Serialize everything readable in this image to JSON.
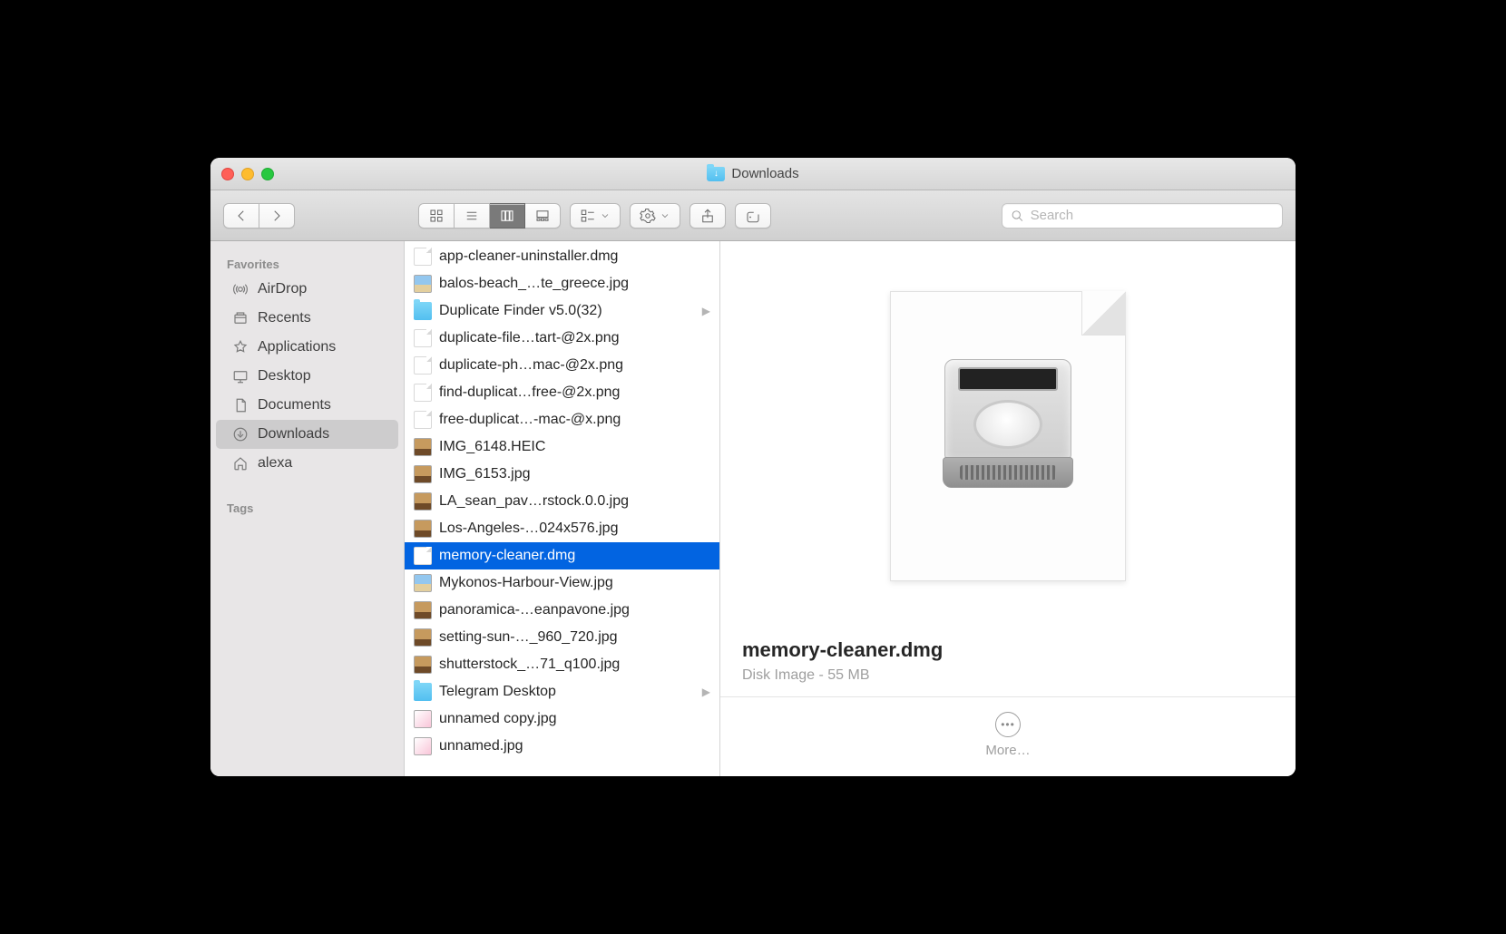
{
  "window": {
    "title": "Downloads"
  },
  "toolbar": {
    "search_placeholder": "Search"
  },
  "sidebar": {
    "favorites_heading": "Favorites",
    "tags_heading": "Tags",
    "items": [
      {
        "label": "AirDrop",
        "icon": "airdrop"
      },
      {
        "label": "Recents",
        "icon": "recents"
      },
      {
        "label": "Applications",
        "icon": "apps"
      },
      {
        "label": "Desktop",
        "icon": "desktop"
      },
      {
        "label": "Documents",
        "icon": "documents"
      },
      {
        "label": "Downloads",
        "icon": "downloads",
        "active": true
      },
      {
        "label": "alexa",
        "icon": "home"
      }
    ]
  },
  "files": [
    {
      "name": "app-cleaner-uninstaller.dmg",
      "kind": "doc"
    },
    {
      "name": "balos-beach_…te_greece.jpg",
      "kind": "img_sky"
    },
    {
      "name": "Duplicate Finder v5.0(32)",
      "kind": "folder",
      "arrow": true
    },
    {
      "name": "duplicate-file…tart-@2x.png",
      "kind": "doc"
    },
    {
      "name": "duplicate-ph…mac-@2x.png",
      "kind": "doc"
    },
    {
      "name": "find-duplicat…free-@2x.png",
      "kind": "doc"
    },
    {
      "name": "free-duplicat…-mac-@x.png",
      "kind": "doc"
    },
    {
      "name": "IMG_6148.HEIC",
      "kind": "img"
    },
    {
      "name": "IMG_6153.jpg",
      "kind": "img"
    },
    {
      "name": "LA_sean_pav…rstock.0.0.jpg",
      "kind": "img"
    },
    {
      "name": "Los-Angeles-…024x576.jpg",
      "kind": "img"
    },
    {
      "name": "memory-cleaner.dmg",
      "kind": "doc",
      "selected": true
    },
    {
      "name": "Mykonos-Harbour-View.jpg",
      "kind": "img_sky"
    },
    {
      "name": "panoramica-…eanpavone.jpg",
      "kind": "img"
    },
    {
      "name": "setting-sun-…_960_720.jpg",
      "kind": "img"
    },
    {
      "name": "shutterstock_…71_q100.jpg",
      "kind": "img"
    },
    {
      "name": "Telegram Desktop",
      "kind": "folder",
      "arrow": true
    },
    {
      "name": "unnamed copy.jpg",
      "kind": "img_pink"
    },
    {
      "name": "unnamed.jpg",
      "kind": "img_pink"
    }
  ],
  "preview": {
    "title": "memory-cleaner.dmg",
    "subtitle": "Disk Image - 55 MB",
    "more_label": "More…"
  }
}
